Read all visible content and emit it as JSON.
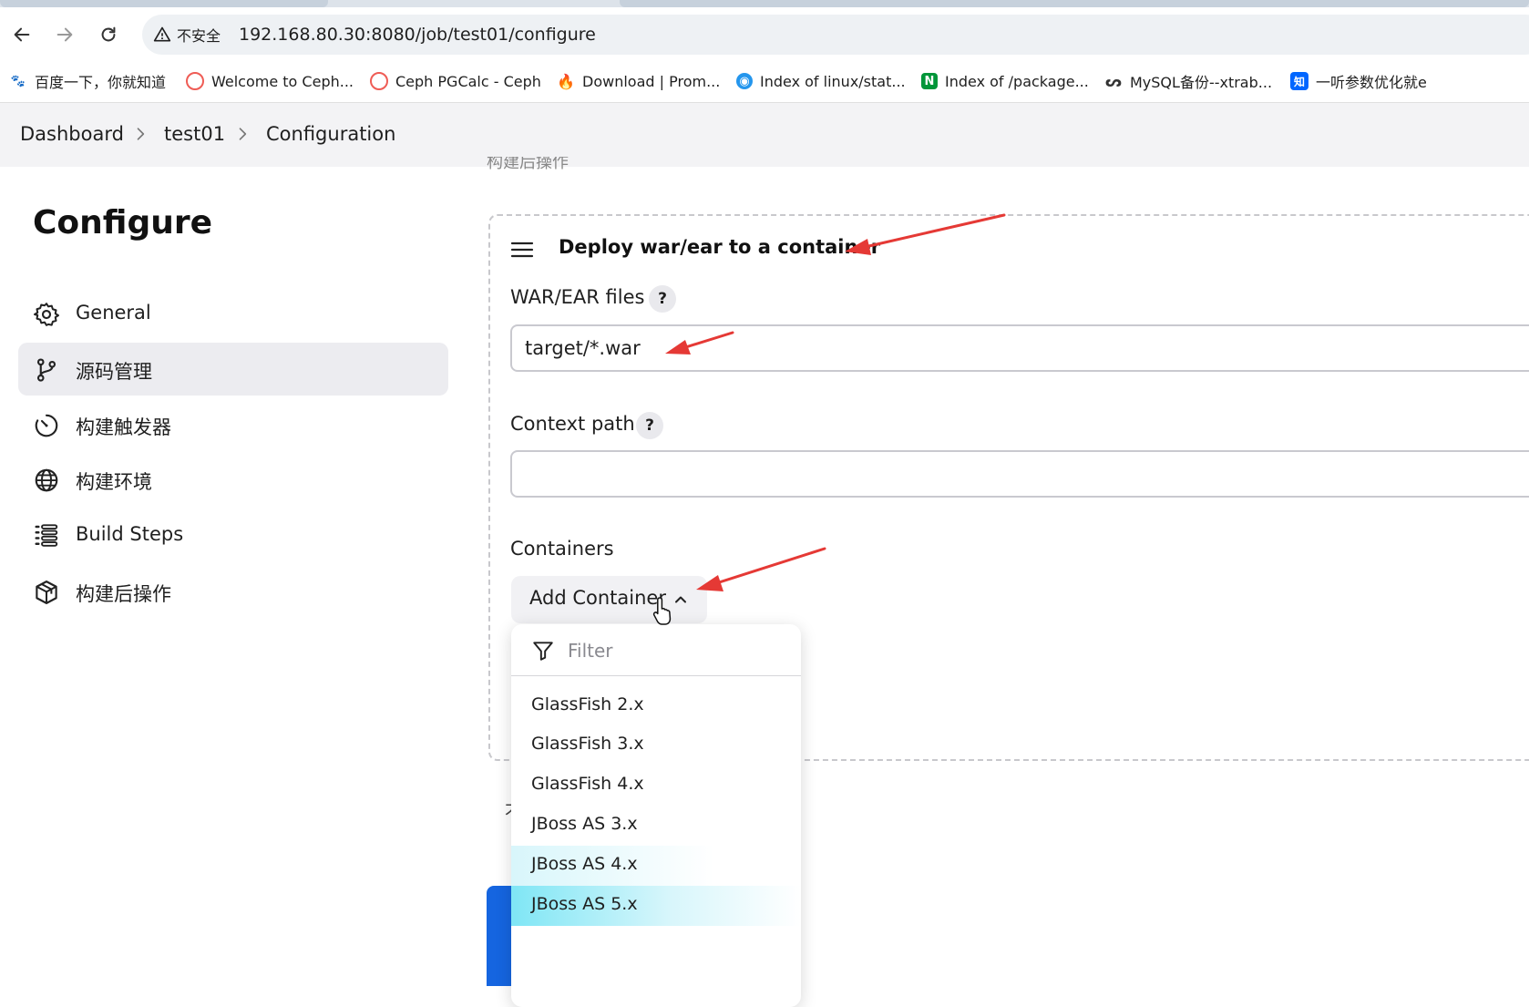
{
  "browser": {
    "insecure_label": "不安全",
    "url": "192.168.80.30:8080/job/test01/configure",
    "bookmarks": [
      {
        "label": "百度一下，你就知道",
        "icon": "baidu-icon",
        "color": "#2932e1"
      },
      {
        "label": "Welcome to Ceph...",
        "icon": "ceph-icon",
        "color": "#ef5c55"
      },
      {
        "label": "Ceph PGCalc - Ceph",
        "icon": "ceph-icon",
        "color": "#ef5c55"
      },
      {
        "label": "Download | Prom...",
        "icon": "prometheus-icon",
        "color": "#e6522c"
      },
      {
        "label": "Index of linux/stat...",
        "icon": "docker-icon",
        "color": "#2496ed"
      },
      {
        "label": "Index of /package...",
        "icon": "nginx-icon",
        "color": "#009639"
      },
      {
        "label": "MySQL备份--xtrab...",
        "icon": "mysql-icon",
        "color": "#333333"
      },
      {
        "label": "一听参数优化就e",
        "icon": "zhihu-icon",
        "color": "#0066ff"
      }
    ]
  },
  "breadcrumb": {
    "items": [
      "Dashboard",
      "test01",
      "Configuration"
    ]
  },
  "sidebar": {
    "title": "Configure",
    "items": [
      {
        "label": "General",
        "icon": "gear-icon",
        "active": false
      },
      {
        "label": "源码管理",
        "icon": "branch-icon",
        "active": true
      },
      {
        "label": "构建触发器",
        "icon": "clock-icon",
        "active": false
      },
      {
        "label": "构建环境",
        "icon": "globe-icon",
        "active": false
      },
      {
        "label": "Build Steps",
        "icon": "list-icon",
        "active": false
      },
      {
        "label": "构建后操作",
        "icon": "package-icon",
        "active": false
      }
    ]
  },
  "section": {
    "ghost_heading": "构建后操作",
    "title": "Deploy war/ear to a container",
    "war_label": "WAR/EAR files",
    "war_value": "target/*.war",
    "context_label": "Context path",
    "context_value": "",
    "help_label": "?",
    "containers_label": "Containers",
    "add_container_label": "Add Container",
    "partial_char": "才"
  },
  "dropdown": {
    "filter_placeholder": "Filter",
    "items": [
      "GlassFish 2.x",
      "GlassFish 3.x",
      "GlassFish 4.x",
      "JBoss AS 3.x",
      "JBoss AS 4.x",
      "JBoss AS 5.x"
    ]
  },
  "colors": {
    "accent": "#1565e0",
    "annotation": "#e53935",
    "highlight": "#7fe6f5"
  }
}
